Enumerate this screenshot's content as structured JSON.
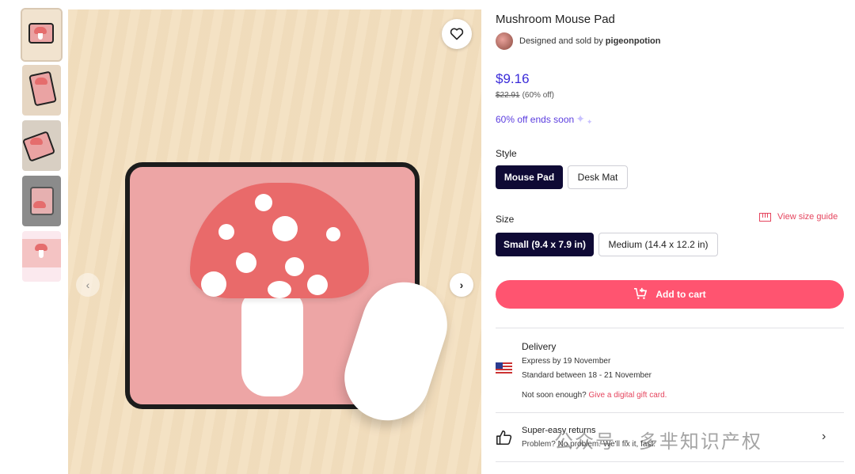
{
  "product": {
    "title": "Mushroom Mouse Pad",
    "seller_prefix": "Designed and sold by",
    "seller_name": "pigeonpotion",
    "price": "$9.16",
    "original_price": "$22.91",
    "discount": "(60% off)",
    "promo": "60% off ends soon",
    "sparkle_icon": "sparkle-icon"
  },
  "style": {
    "label": "Style",
    "options": [
      "Mouse Pad",
      "Desk Mat"
    ],
    "selected": "Mouse Pad"
  },
  "size": {
    "label": "Size",
    "guide_label": "View size guide",
    "options": [
      "Small (9.4 x 7.9 in)",
      "Medium (14.4 x 12.2 in)"
    ],
    "selected": "Small (9.4 x 7.9 in)"
  },
  "cart": {
    "label": "Add to cart",
    "icon": "cart-plus-icon",
    "color": "#ff5470"
  },
  "delivery": {
    "title": "Delivery",
    "express": "Express by 19 November",
    "standard": "Standard between 18 - 21 November",
    "question": "Not soon enough?",
    "gift_link": "Give a digital gift card.",
    "flag_icon": "us-flag-icon"
  },
  "returns": {
    "title": "Super-easy returns",
    "subtitle": "Problem? No problem. We'll fix it, fast.",
    "icon": "thumbs-up-icon"
  },
  "gallery": {
    "thumbnail_count": 5,
    "active_index": 0,
    "favorite_icon": "heart-icon",
    "prev_icon": "chevron-left-icon",
    "next_icon": "chevron-right-icon"
  },
  "watermark": "公众号 · 多芈知识产权",
  "colors": {
    "accent_price": "#3a2bd9",
    "selected_chip": "#0f0a35",
    "link": "#e5455e"
  }
}
